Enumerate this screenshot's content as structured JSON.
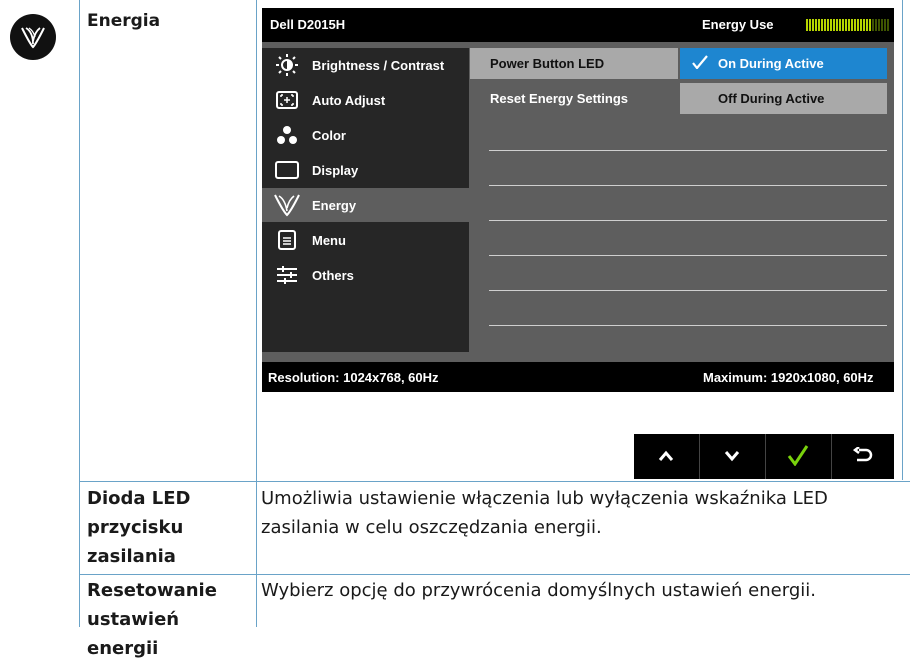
{
  "section": {
    "title": "Energia"
  },
  "osd": {
    "model": "Dell D2015H",
    "energy_use_label": "Energy Use",
    "energy_level_percent": 80,
    "menu": [
      {
        "icon": "brightness-icon",
        "label": "Brightness / Contrast"
      },
      {
        "icon": "auto-adjust-icon",
        "label": "Auto Adjust"
      },
      {
        "icon": "color-icon",
        "label": "Color"
      },
      {
        "icon": "display-icon",
        "label": "Display"
      },
      {
        "icon": "energy-icon",
        "label": "Energy"
      },
      {
        "icon": "menu-icon",
        "label": "Menu"
      },
      {
        "icon": "others-icon",
        "label": "Others"
      }
    ],
    "active_menu_label": "Energy",
    "submenu": [
      {
        "label": "Power Button LED",
        "selected": true
      },
      {
        "label": "Reset Energy Settings",
        "selected": false
      }
    ],
    "options": [
      {
        "label": "On During Active",
        "selected": true
      },
      {
        "label": "Off During Active",
        "selected": false
      }
    ],
    "resolution": "Resolution: 1024x768, 60Hz",
    "maximum": "Maximum: 1920x1080, 60Hz",
    "colors": {
      "selection_blue": "#1e86d0",
      "submenu_selected": "#a9a9a9",
      "meter_green": "#b6d400",
      "check_green": "#79d20c"
    }
  },
  "nav_buttons": [
    {
      "icon": "chevron-up-icon"
    },
    {
      "icon": "chevron-down-icon"
    },
    {
      "icon": "checkmark-icon"
    },
    {
      "icon": "back-icon"
    }
  ],
  "table": {
    "rows": [
      {
        "term": "Dioda LED przycisku zasilania",
        "term_lines": [
          "Dioda LED",
          "przycisku",
          "zasilania"
        ],
        "description_lines": [
          "Umożliwia ustawienie włączenia lub wyłączenia wskaźnika LED",
          "zasilania w celu oszczędzania energii."
        ]
      },
      {
        "term": "Resetowanie ustawień energii",
        "term_lines": [
          "Resetowanie",
          "ustawień energii"
        ],
        "description_lines": [
          "Wybierz opcję do przywrócenia domyślnych ustawień energii."
        ]
      }
    ]
  }
}
